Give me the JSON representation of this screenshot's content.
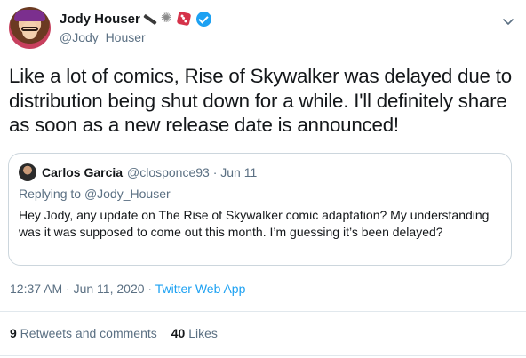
{
  "author": {
    "display_name": "Jody Houser",
    "handle": "@Jody_Houser",
    "name_emojis": [
      "pen-emoji",
      "burst-emoji",
      "die-emoji"
    ],
    "verified": true
  },
  "tweet": {
    "text": "Like a lot of comics, Rise of Skywalker was delayed due to distribution being shut down for a while. I'll definitely share as soon as a new release date is announced!"
  },
  "quoted_tweet": {
    "display_name": "Carlos Garcia",
    "handle_and_date": "@closponce93 · Jun 11",
    "reply_prefix": "Replying to ",
    "reply_target": "@Jody_Houser",
    "text": "Hey Jody, any update on The Rise of Skywalker comic adaptation? My understanding was it was supposed to come out this month. I’m guessing it’s been delayed?"
  },
  "meta": {
    "timestamp": "12:37 AM · Jun 11, 2020 · ",
    "source": "Twitter Web App"
  },
  "stats": {
    "retweets_count": "9",
    "retweets_label": " Retweets and comments",
    "likes_count": "40",
    "likes_label": " Likes"
  },
  "colors": {
    "link": "#1da1f2",
    "secondary_text": "#5b7083",
    "border": "#ccd6dd"
  }
}
